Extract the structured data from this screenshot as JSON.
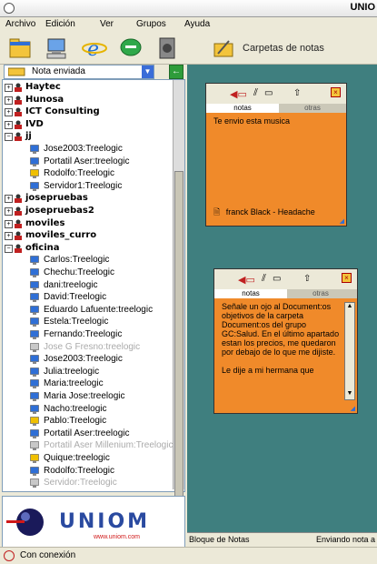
{
  "window": {
    "title": "UNIO"
  },
  "menu": [
    "Archivo",
    "Edición",
    "Ver",
    "Grupos",
    "Ayuda"
  ],
  "toolbar": {
    "carpetas_label": "Carpetas de notas"
  },
  "status_selector": {
    "value": "Nota enviada"
  },
  "tree": [
    {
      "type": "group",
      "label": "Haytec",
      "expanded": true
    },
    {
      "type": "group",
      "label": "Hunosa",
      "expanded": true
    },
    {
      "type": "group",
      "label": "ICT Consulting",
      "expanded": true
    },
    {
      "type": "group",
      "label": "IVD",
      "expanded": true
    },
    {
      "type": "group",
      "label": "jj",
      "expanded": false
    },
    {
      "type": "user",
      "label": "Jose2003:Treelogic",
      "status": "online"
    },
    {
      "type": "user",
      "label": "Portatil Aser:treelogic",
      "status": "online"
    },
    {
      "type": "user",
      "label": "Rodolfo:Treelogic",
      "status": "away"
    },
    {
      "type": "user",
      "label": "Servidor1:Treelogic",
      "status": "online"
    },
    {
      "type": "group",
      "label": "josepruebas",
      "expanded": true
    },
    {
      "type": "group",
      "label": "josepruebas2",
      "expanded": true
    },
    {
      "type": "group",
      "label": "moviles",
      "expanded": true
    },
    {
      "type": "group",
      "label": "moviles_curro",
      "expanded": true
    },
    {
      "type": "group",
      "label": "oficina",
      "expanded": false
    },
    {
      "type": "user",
      "label": "Carlos:Treelogic",
      "status": "online"
    },
    {
      "type": "user",
      "label": "Chechu:Treelogic",
      "status": "online"
    },
    {
      "type": "user",
      "label": "dani:treelogic",
      "status": "online"
    },
    {
      "type": "user",
      "label": "David:Treelogic",
      "status": "online"
    },
    {
      "type": "user",
      "label": "Eduardo Lafuente:treelogic",
      "status": "online"
    },
    {
      "type": "user",
      "label": "Estela:Treelogic",
      "status": "online"
    },
    {
      "type": "user",
      "label": "Fernando:Treelogic",
      "status": "online"
    },
    {
      "type": "user",
      "label": "Jose G Fresno:treelogic",
      "status": "offline"
    },
    {
      "type": "user",
      "label": "Jose2003:Treelogic",
      "status": "online"
    },
    {
      "type": "user",
      "label": "Julia:treelogic",
      "status": "online"
    },
    {
      "type": "user",
      "label": "Maria:treelogic",
      "status": "online"
    },
    {
      "type": "user",
      "label": "Maria Jose:treelogic",
      "status": "online"
    },
    {
      "type": "user",
      "label": "Nacho:treelogic",
      "status": "online"
    },
    {
      "type": "user",
      "label": "Pablo:Treelogic",
      "status": "away"
    },
    {
      "type": "user",
      "label": "Portatil Aser:treelogic",
      "status": "online"
    },
    {
      "type": "user",
      "label": "Portatil Aser Millenium:Treelogic",
      "status": "offline"
    },
    {
      "type": "user",
      "label": "Quique:treelogic",
      "status": "away"
    },
    {
      "type": "user",
      "label": "Rodolfo:Treelogic",
      "status": "online"
    },
    {
      "type": "user",
      "label": "Servidor:Treelogic",
      "status": "offline"
    }
  ],
  "logo": {
    "brand": "UNIOM",
    "url": "www.uniom.com"
  },
  "note1": {
    "tab_active": "notas",
    "tab_other": "otras",
    "text": "Te envio esta musica",
    "attachment": "franck Black - Headache"
  },
  "note2": {
    "tab_active": "notas",
    "tab_other": "otras",
    "text": "Señale un ojo al Document:os objetivos de la carpeta Document:os del grupo GC:Salud. En el último apartado estan los precios, me quedaron por debajo de lo que me dijiste.\n\nLe dije a mi hermana que"
  },
  "bottombar": {
    "left": "Bloque de Notas",
    "right": "Enviando nota a"
  },
  "status": {
    "text": "Con conexión"
  },
  "colors": {
    "note_bg": "#f08a2a",
    "panel_bg": "#3f7f7f",
    "online": "#2f6fd6",
    "away": "#f0c000",
    "offline": "#c8c8c8"
  }
}
